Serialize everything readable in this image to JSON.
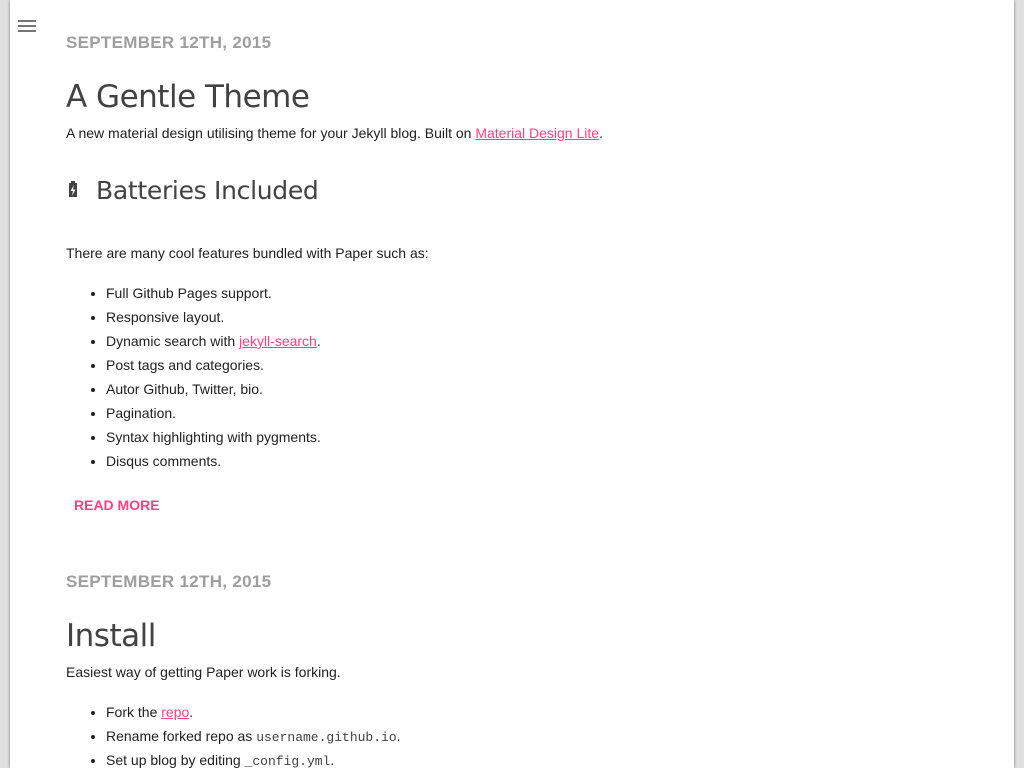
{
  "menu": {
    "icon": "menu-icon"
  },
  "posts": [
    {
      "date": "September 12th, 2015",
      "title": "A Gentle Theme",
      "intro_text": "A new material design utilising theme for your Jekyll blog. Built on ",
      "intro_link": "Material Design Lite",
      "intro_end": ".",
      "section_heading": "Batteries Included",
      "section_icon": "battery-charging-icon",
      "section_intro": "There are many cool features bundled with Paper such as:",
      "features": [
        {
          "text": "Full Github Pages support."
        },
        {
          "text": "Responsive layout."
        },
        {
          "text": "Dynamic search with ",
          "link": "jekyll-search",
          "after": "."
        },
        {
          "text": "Post tags and categories."
        },
        {
          "text": "Autor Github, Twitter, bio."
        },
        {
          "text": "Pagination."
        },
        {
          "text": "Syntax highlighting with pygments."
        },
        {
          "text": "Disqus comments."
        }
      ],
      "read_more": "Read more"
    },
    {
      "date": "September 12th, 2015",
      "title": "Install",
      "intro_text": "Easiest way of getting Paper work is forking.",
      "steps": [
        {
          "before": "Fork the ",
          "link": "repo",
          "after": "."
        },
        {
          "before": "Rename forked repo as ",
          "code": "username.github.io",
          "after": "."
        },
        {
          "before": "Set up blog by editing ",
          "code": "_config.yml",
          "after": "."
        }
      ]
    }
  ],
  "colors": {
    "accent": "#ff4081",
    "date": "#9e9e9e",
    "title": "#424242",
    "body_text": "#212121"
  }
}
